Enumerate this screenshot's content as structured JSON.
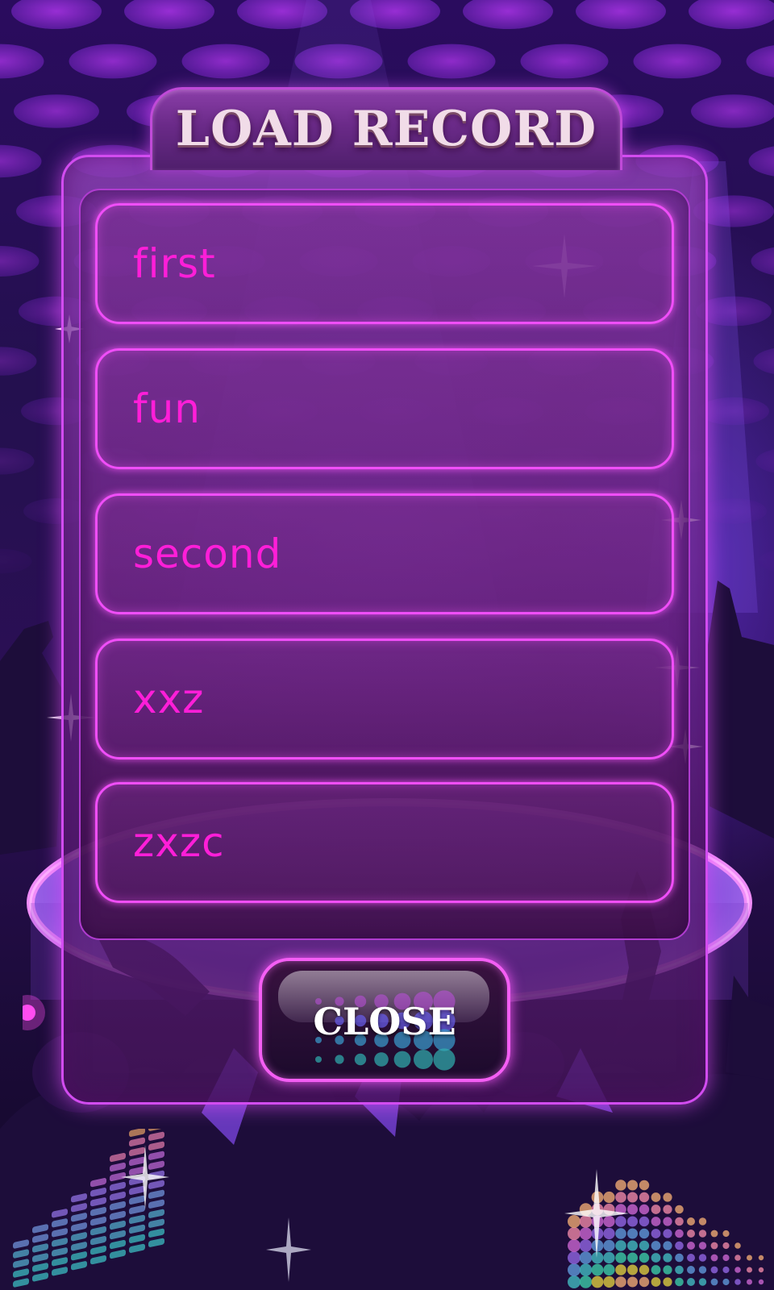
{
  "dialog": {
    "title": "LOAD RECORD",
    "records": [
      {
        "label": "first"
      },
      {
        "label": "fun"
      },
      {
        "label": "second"
      },
      {
        "label": "xxz"
      },
      {
        "label": "zxzc"
      }
    ],
    "close_label": "CLOSE"
  },
  "colors": {
    "record_text": "#ff1ed8",
    "record_border": "#f04ef8",
    "panel_glow": "#d24cf0",
    "title_text": "#f1dce8"
  },
  "icons": {
    "sparkle": "sparkle-icon",
    "equalizer": "equalizer-icon"
  }
}
